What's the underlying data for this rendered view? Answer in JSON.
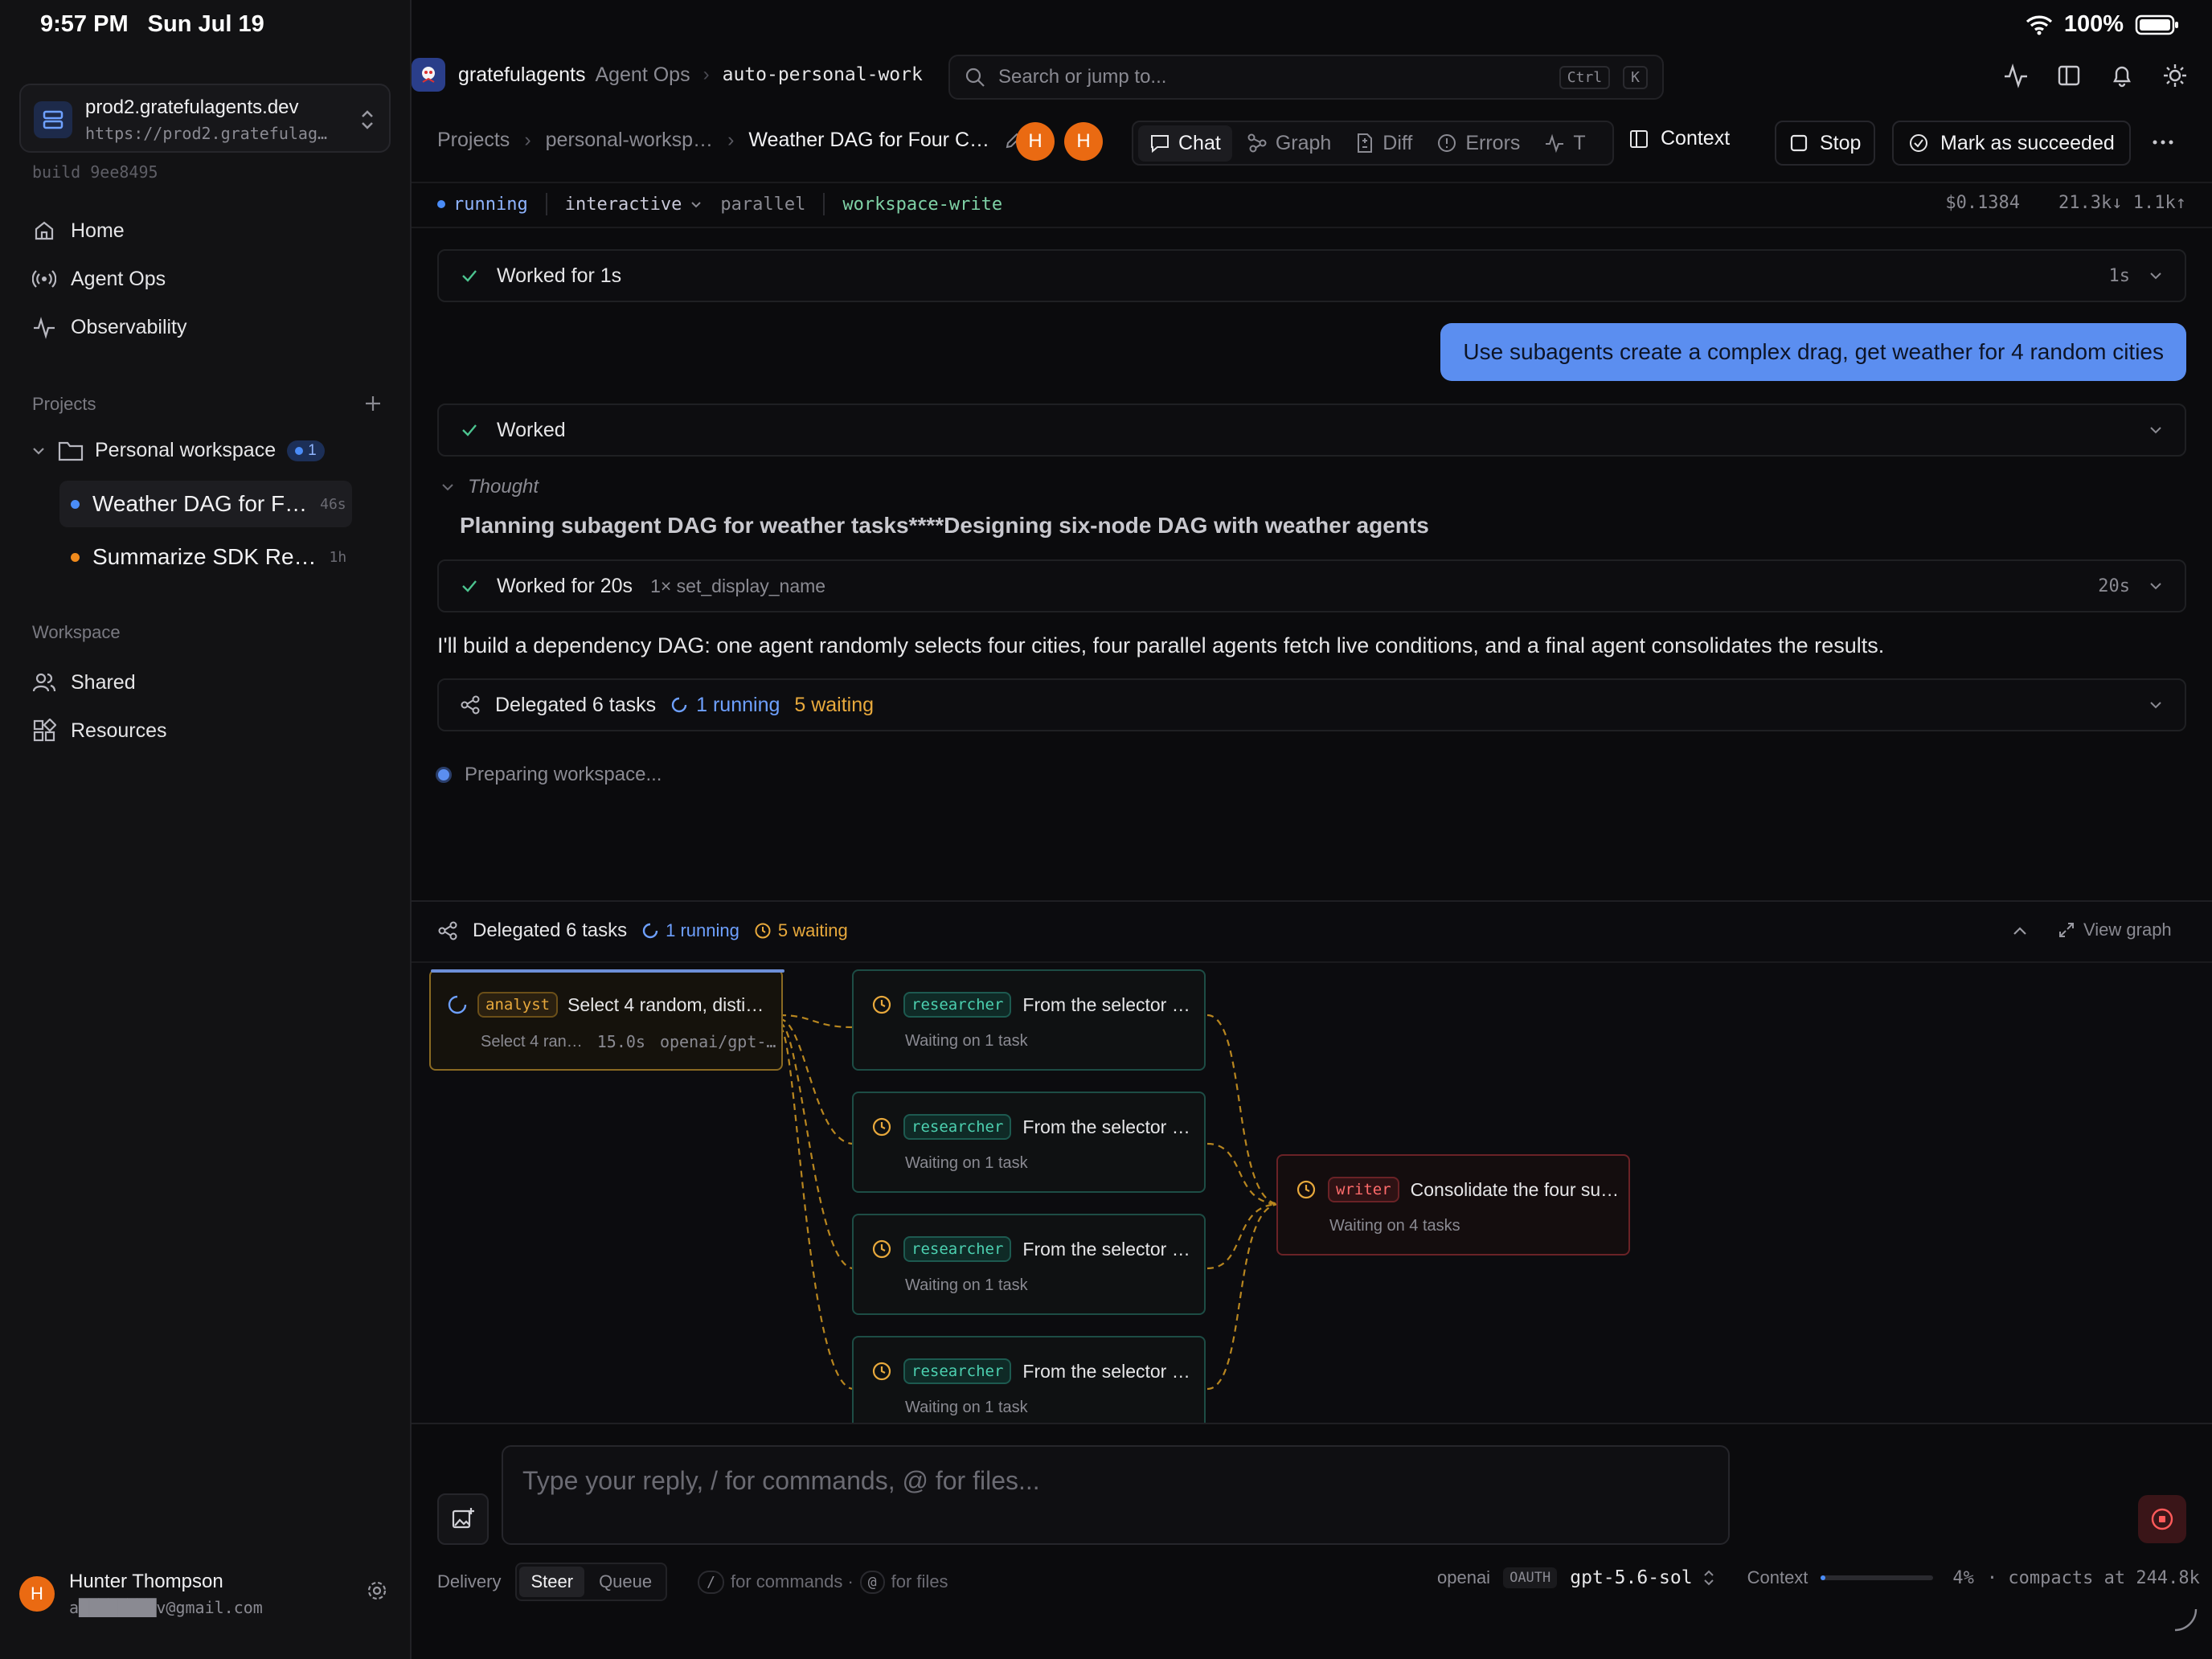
{
  "status_bar": {
    "time": "9:57 PM",
    "date": "Sun Jul 19",
    "battery": "100%"
  },
  "sidebar": {
    "server": {
      "name": "prod2.gratefulagents.dev",
      "url": "https://prod2.gratefulag…"
    },
    "build": "build 9ee8495",
    "nav": [
      {
        "label": "Home",
        "icon": "home-icon"
      },
      {
        "label": "Agent Ops",
        "icon": "broadcast-icon"
      },
      {
        "label": "Observability",
        "icon": "activity-icon"
      }
    ],
    "projects_label": "Projects",
    "project": {
      "name": "Personal workspace",
      "badge": "1"
    },
    "tasks": [
      {
        "title": "Weather DAG for F…",
        "age": "46s",
        "color": "#4a8cf7"
      },
      {
        "title": "Summarize SDK Re…",
        "age": "1h",
        "color": "#f08a1c"
      }
    ],
    "workspace_label": "Workspace",
    "workspace_items": [
      {
        "label": "Shared",
        "icon": "users-icon"
      },
      {
        "label": "Resources",
        "icon": "grid-icon"
      }
    ],
    "user": {
      "initial": "H",
      "name": "Hunter Thompson",
      "email": "a████████v@gmail.com"
    }
  },
  "topbar": {
    "brand": "gratefulagents",
    "section": "Agent Ops",
    "branch": "auto-personal-work",
    "search_placeholder": "Search or jump to...",
    "shortcut_ctrl": "Ctrl",
    "shortcut_k": "K"
  },
  "header": {
    "breadcrumb": [
      "Projects",
      "personal-worksp…",
      "Weather DAG for Four C…"
    ],
    "avatars": [
      "H",
      "H"
    ],
    "tabs": [
      "Chat",
      "Graph",
      "Diff",
      "Errors",
      "T"
    ],
    "context_label": "Context",
    "stop_label": "Stop",
    "succeed_label": "Mark as succeeded"
  },
  "meta": {
    "status": "running",
    "mode": "interactive",
    "mode2": "parallel",
    "permission": "workspace-write",
    "cost": "$0.1384",
    "tokens": "21.3k↓ 1.1k↑"
  },
  "chat": {
    "worked1": {
      "label": "Worked for 1s",
      "time": "1s"
    },
    "user_message": "Use subagents create a complex drag, get weather for 4 random cities",
    "worked2": {
      "label": "Worked"
    },
    "thought_label": "Thought",
    "thought_text": "Planning subagent DAG for weather tasks****Designing six-node DAG with weather agents",
    "worked3": {
      "label": "Worked for 20s",
      "tool": "1× set_display_name",
      "time": "20s"
    },
    "assistant_text": "I'll build a dependency DAG: one agent randomly selects four cities, four parallel agents fetch live conditions, and a final agent consolidates the results.",
    "delegated": {
      "label": "Delegated 6 tasks",
      "running": "1 running",
      "waiting": "5 waiting"
    },
    "preparing": "Preparing workspace..."
  },
  "graph_panel": {
    "label": "Delegated 6 tasks",
    "running": "1 running",
    "waiting": "5 waiting",
    "view_graph": "View graph",
    "nodes": [
      {
        "role": "analyst",
        "title": "Select 4 random, disti…",
        "sub": "Select 4 ran…",
        "time": "15.0s",
        "model": "openai/gpt-…",
        "status": "running"
      },
      {
        "role": "researcher",
        "title": "From the selector …",
        "sub": "Waiting on 1 task",
        "status": "waiting"
      },
      {
        "role": "researcher",
        "title": "From the selector …",
        "sub": "Waiting on 1 task",
        "status": "waiting"
      },
      {
        "role": "researcher",
        "title": "From the selector …",
        "sub": "Waiting on 1 task",
        "status": "waiting"
      },
      {
        "role": "researcher",
        "title": "From the selector …",
        "sub": "Waiting on 1 task",
        "status": "waiting"
      },
      {
        "role": "writer",
        "title": "Consolidate the four su…",
        "sub": "Waiting on 4 tasks",
        "status": "waiting"
      }
    ]
  },
  "composer": {
    "placeholder": "Type your reply, / for commands, @ for files...",
    "delivery_label": "Delivery",
    "steer": "Steer",
    "queue": "Queue",
    "slash_key": "/",
    "slash_hint": "for commands ·",
    "at_key": "@",
    "at_hint": "for files",
    "provider": "openai",
    "auth": "OAUTH",
    "model": "gpt-5.6-sol",
    "context_label": "Context",
    "context_percent": "4%",
    "context_fill": 0.04,
    "compacts": "· compacts at 244.8k"
  },
  "colors": {
    "accent": "#4a8cf7",
    "running": "#4a8cf7",
    "waiting": "#e8a93c",
    "researcher": "#2fb59a",
    "writer": "#e05a5a",
    "avatar": "#ea6a12"
  }
}
